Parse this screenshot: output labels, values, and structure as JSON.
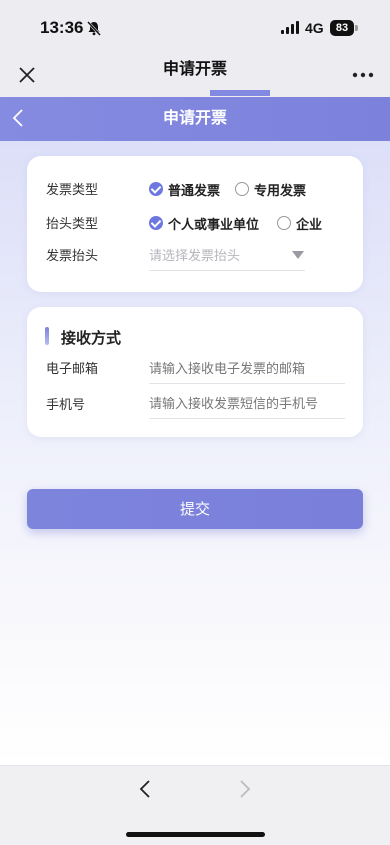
{
  "status_bar": {
    "time": "13:36",
    "network": "4G",
    "battery": "83"
  },
  "browser": {
    "title": "申请开票",
    "accent_color": "#8289e0"
  },
  "header": {
    "title": "申请开票",
    "color": "#7c82dc"
  },
  "invoice_card": {
    "invoice_type": {
      "label": "发票类型",
      "options": [
        {
          "label": "普通发票",
          "checked": true
        },
        {
          "label": "专用发票",
          "checked": false
        }
      ]
    },
    "title_type": {
      "label": "抬头类型",
      "options": [
        {
          "label": "个人或事业单位",
          "checked": true
        },
        {
          "label": "企业",
          "checked": false
        }
      ]
    },
    "invoice_title": {
      "label": "发票抬头",
      "placeholder": "请选择发票抬头"
    }
  },
  "receive_card": {
    "title": "接收方式",
    "email": {
      "label": "电子邮箱",
      "placeholder": "请输入接收电子发票的邮箱"
    },
    "phone": {
      "label": "手机号",
      "placeholder": "请输入接收发票短信的手机号"
    }
  },
  "submit_label": "提交",
  "icons": [
    "bell-off-icon",
    "signal-icon",
    "battery-icon",
    "close-icon",
    "more-icon",
    "back-icon",
    "prev-icon",
    "next-icon"
  ]
}
